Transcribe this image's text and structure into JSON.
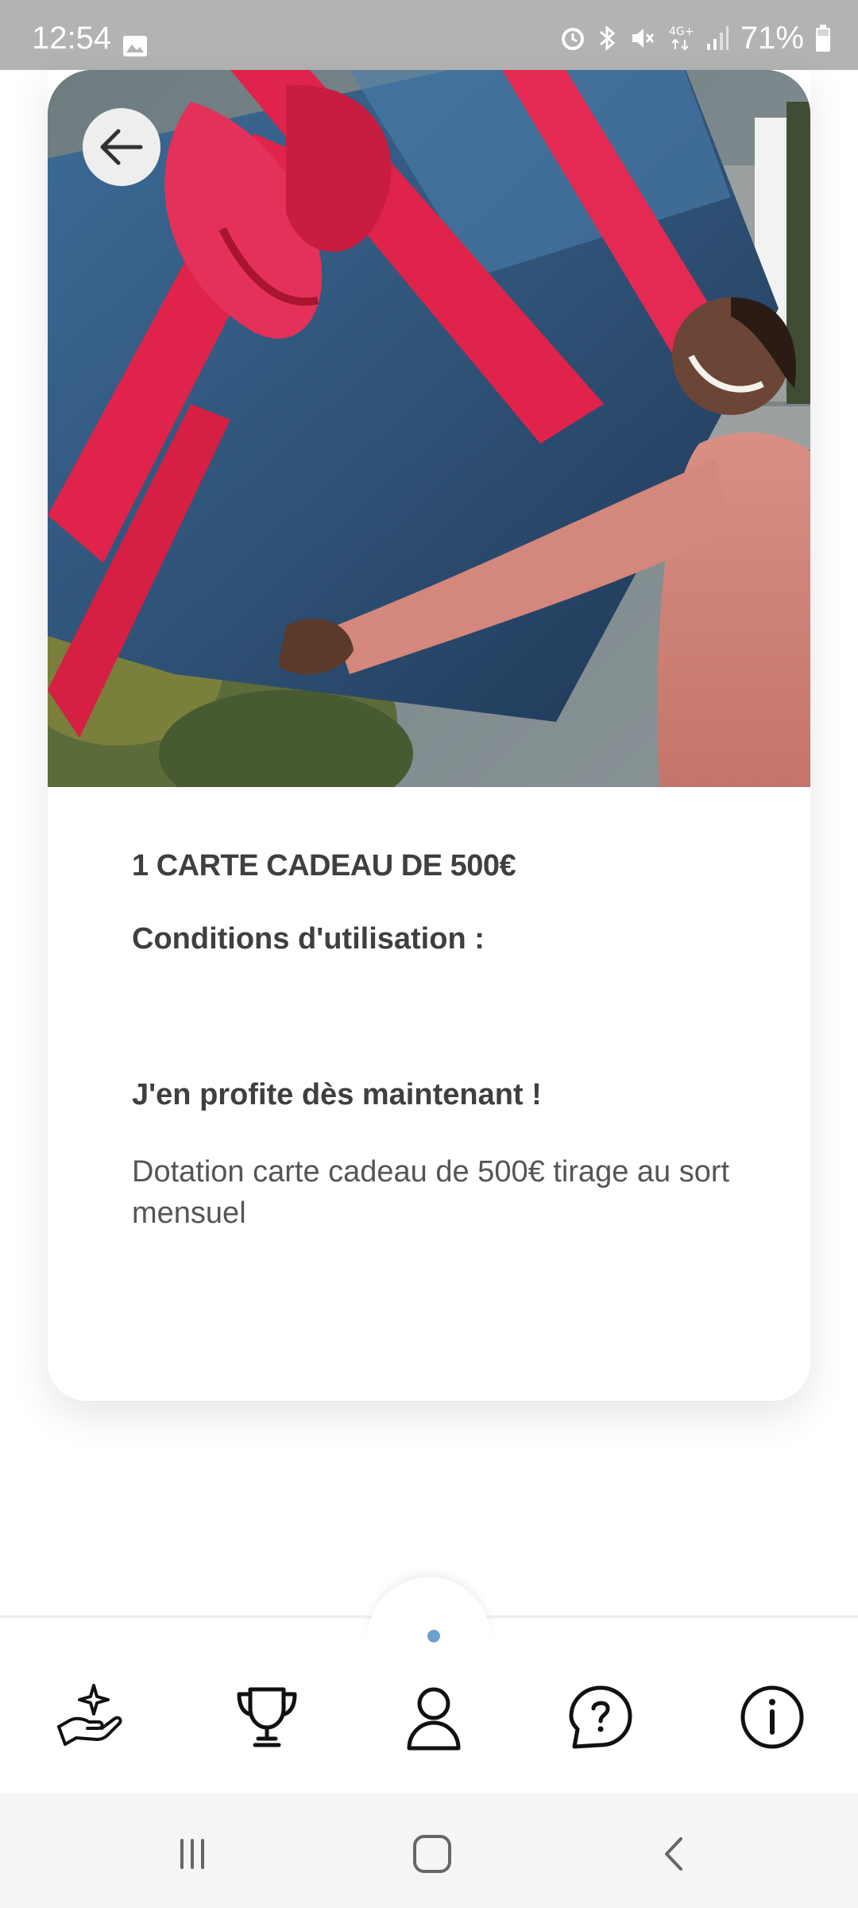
{
  "status_bar": {
    "time": "12:54",
    "battery": "71%",
    "icons": [
      "gallery-icon",
      "alarm-icon",
      "bluetooth-icon",
      "mute-icon",
      "lte-icon",
      "signal-icon",
      "battery-icon"
    ]
  },
  "hero": {
    "back_icon": "arrow-left-icon"
  },
  "reward": {
    "title": "1 CARTE CADEAU DE 500€",
    "conditions_heading": "Conditions d'utilisation :",
    "cta": "J'en profite dès maintenant !",
    "description": "Dotation carte cadeau de 500€ tirage au sort mensuel"
  },
  "bottom_nav": {
    "items": [
      {
        "icon": "rewards-hand-icon"
      },
      {
        "icon": "trophy-icon"
      },
      {
        "icon": "profile-icon"
      },
      {
        "icon": "help-icon"
      },
      {
        "icon": "info-icon"
      }
    ],
    "active_index": 2,
    "accent": "#6da0cf"
  },
  "system_nav": {
    "icons": [
      "recents-icon",
      "home-icon",
      "back-icon"
    ]
  }
}
